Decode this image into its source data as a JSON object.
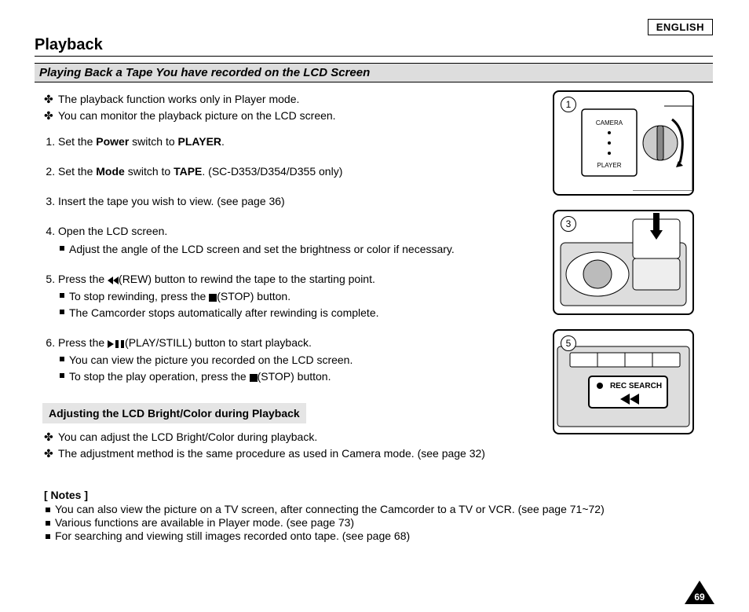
{
  "lang": "ENGLISH",
  "title": "Playback",
  "section": "Playing Back a Tape You have recorded on the LCD Screen",
  "intro": [
    "The playback function works only in Player mode.",
    "You can monitor the playback picture on the LCD screen."
  ],
  "steps": {
    "s1a": "Set the ",
    "s1b": "Power",
    "s1c": " switch to ",
    "s1d": "PLAYER",
    "s1e": ".",
    "s2a": "Set the ",
    "s2b": "Mode",
    "s2c": " switch to ",
    "s2d": "TAPE",
    "s2e": ". (SC-D353/D354/D355 only)",
    "s3": "Insert the tape you wish to view. (see page 36)",
    "s4": "Open the LCD screen.",
    "s4sub1": "Adjust the angle of the LCD screen and set the brightness or color if necessary.",
    "s5a": "Press the  ",
    "s5b": "(REW) button to rewind the tape to the starting point.",
    "s5sub1a": "To stop rewinding, press the  ",
    "s5sub1b": "(STOP) button.",
    "s5sub2": "The Camcorder stops automatically after rewinding is complete.",
    "s6a": "Press the  ",
    "s6b": "(PLAY/STILL) button to start playback.",
    "s6sub1": "You can view the picture you recorded on the LCD screen.",
    "s6sub2a": "To stop the play operation, press the  ",
    "s6sub2b": "(STOP) button."
  },
  "adjust": {
    "heading": "Adjusting the LCD Bright/Color during Playback",
    "items": [
      "You can adjust the LCD Bright/Color during playback.",
      "The adjustment method is the same procedure as used in Camera mode. (see page 32)"
    ]
  },
  "notesHeading": "[ Notes ]",
  "notes": [
    "You can also view the picture on a TV screen, after connecting the Camcorder to a TV or VCR. (see page 71~72)",
    "Various functions are available in Player mode. (see page 73)",
    "For searching and viewing still images recorded onto tape. (see page 68)"
  ],
  "figs": {
    "f1": "1",
    "f1camera": "CAMERA",
    "f1player": "PLAYER",
    "f3": "3",
    "f5": "5",
    "f5label": "REC SEARCH"
  },
  "pagenum": "69"
}
